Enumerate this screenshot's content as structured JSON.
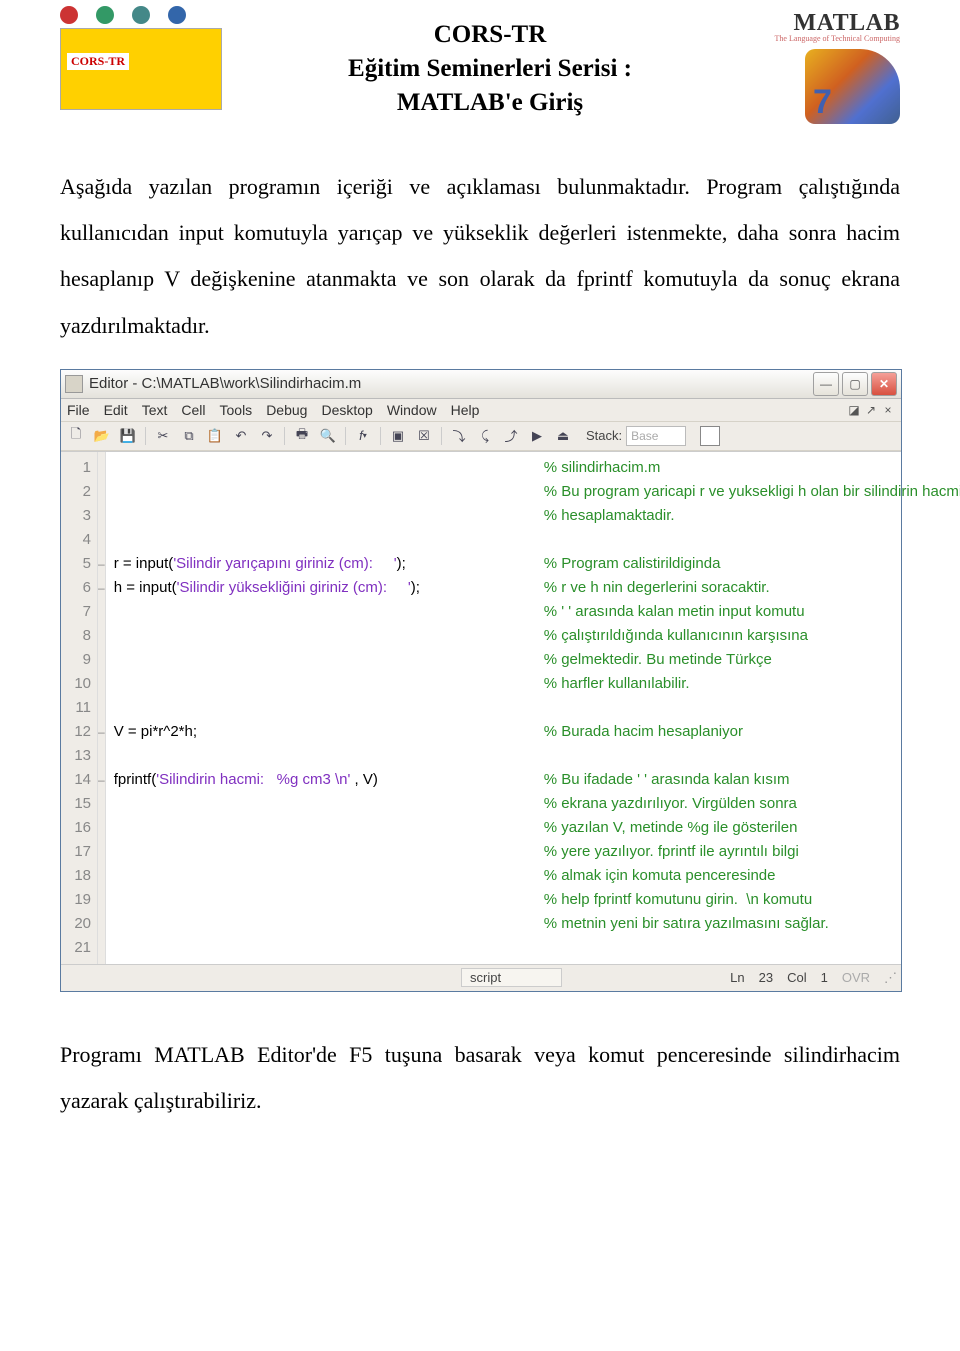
{
  "header": {
    "title_line1": "CORS-TR",
    "title_line2": "Eğitim Seminerleri Serisi :",
    "title_line3": "MATLAB'e Giriş",
    "matlab_logo_text": "MATLAB",
    "matlab_logo_sub": "The Language of Technical Computing"
  },
  "para1": "Aşağıda yazılan programın içeriği ve açıklaması bulunmaktadır. Program çalıştığında kullanıcıdan input komutuyla yarıçap ve yükseklik değerleri istenmekte, daha sonra hacim hesaplanıp V değişkenine atanmakta ve son olarak da fprintf komutuyla da sonuç ekrana yazdırılmaktadır.",
  "editor": {
    "title": "Editor - C:\\MATLAB\\work\\Silindirhacim.m",
    "menus": [
      "File",
      "Edit",
      "Text",
      "Cell",
      "Tools",
      "Debug",
      "Desktop",
      "Window",
      "Help"
    ],
    "stack_label": "Stack:",
    "stack_value": "Base",
    "lines": [
      {
        "n": "1",
        "bp": "",
        "code": "",
        "comment": "% silindirhacim.m"
      },
      {
        "n": "2",
        "bp": "",
        "code": "",
        "comment": "% Bu program yaricapi r ve yuksekligi h olan bir silindirin hacmini"
      },
      {
        "n": "3",
        "bp": "",
        "code": "",
        "comment": "% hesaplamaktadir."
      },
      {
        "n": "4",
        "bp": "",
        "code": "",
        "comment": ""
      },
      {
        "n": "5",
        "bp": "–",
        "code": "r = input('Silindir yarıçapını giriniz (cm):     ');",
        "comment": "% Program calistirildiginda"
      },
      {
        "n": "6",
        "bp": "–",
        "code": "h = input('Silindir yüksekliğini giriniz (cm):     ');",
        "comment": "% r ve h nin degerlerini soracaktir."
      },
      {
        "n": "7",
        "bp": "",
        "code": "",
        "comment": "% ' ' arasında kalan metin input komutu"
      },
      {
        "n": "8",
        "bp": "",
        "code": "",
        "comment": "% çalıştırıldığında kullanıcının karşısına"
      },
      {
        "n": "9",
        "bp": "",
        "code": "",
        "comment": "% gelmektedir. Bu metinde Türkçe"
      },
      {
        "n": "10",
        "bp": "",
        "code": "",
        "comment": "% harfler kullanılabilir."
      },
      {
        "n": "11",
        "bp": "",
        "code": "",
        "comment": ""
      },
      {
        "n": "12",
        "bp": "–",
        "code": "V = pi*r^2*h;",
        "comment": "% Burada hacim hesaplaniyor"
      },
      {
        "n": "13",
        "bp": "",
        "code": "",
        "comment": ""
      },
      {
        "n": "14",
        "bp": "–",
        "code": "fprintf('Silindirin hacmi:   %g cm3 \\n' , V)",
        "comment": "% Bu ifadade ' ' arasında kalan kısım"
      },
      {
        "n": "15",
        "bp": "",
        "code": "",
        "comment": "% ekrana yazdırılıyor. Virgülden sonra"
      },
      {
        "n": "16",
        "bp": "",
        "code": "",
        "comment": "% yazılan V, metinde %g ile gösterilen"
      },
      {
        "n": "17",
        "bp": "",
        "code": "",
        "comment": "% yere yazılıyor. fprintf ile ayrıntılı bilgi"
      },
      {
        "n": "18",
        "bp": "",
        "code": "",
        "comment": "% almak için komuta penceresinde"
      },
      {
        "n": "19",
        "bp": "",
        "code": "",
        "comment": "% help fprintf komutunu girin.  \\n komutu"
      },
      {
        "n": "20",
        "bp": "",
        "code": "",
        "comment": "% metnin yeni bir satıra yazılmasını sağlar."
      },
      {
        "n": "21",
        "bp": "",
        "code": "",
        "comment": ""
      }
    ],
    "status": {
      "type": "script",
      "ln_label": "Ln",
      "ln": "23",
      "col_label": "Col",
      "col": "1",
      "ovr": "OVR"
    }
  },
  "para2": "Programı MATLAB Editor'de F5 tuşuna basarak veya komut penceresinde silindirhacim yazarak çalıştırabiliriz."
}
